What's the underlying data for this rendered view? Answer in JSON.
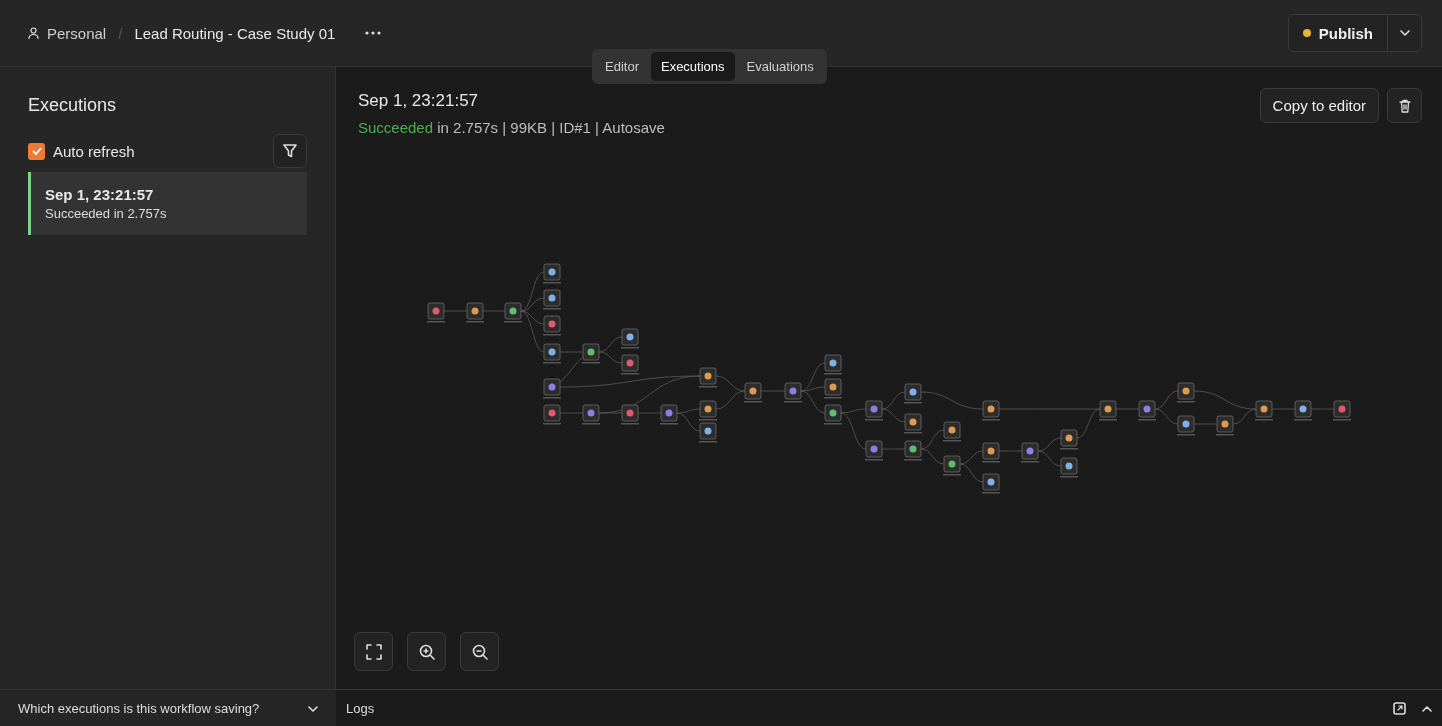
{
  "breadcrumb": {
    "owner": "Personal",
    "separator": "/",
    "title": "Lead Routing - Case Study 01"
  },
  "tabs": [
    {
      "label": "Editor",
      "selected": false
    },
    {
      "label": "Executions",
      "selected": true
    },
    {
      "label": "Evaluations",
      "selected": false
    }
  ],
  "publish": {
    "label": "Publish"
  },
  "sidebar": {
    "title": "Executions",
    "auto_refresh": {
      "label": "Auto refresh",
      "checked": true
    },
    "executions": [
      {
        "time": "Sep 1, 23:21:57",
        "status": "Succeeded in 2.757s",
        "selected": true
      }
    ],
    "footer": "Which executions is this workflow saving?"
  },
  "execution": {
    "time": "Sep 1, 23:21:57",
    "status": "Succeeded",
    "details": "in 2.757s | 99KB | ID#1 | Autosave",
    "copy_button": "Copy to editor"
  },
  "logs": {
    "title": "Logs"
  }
}
